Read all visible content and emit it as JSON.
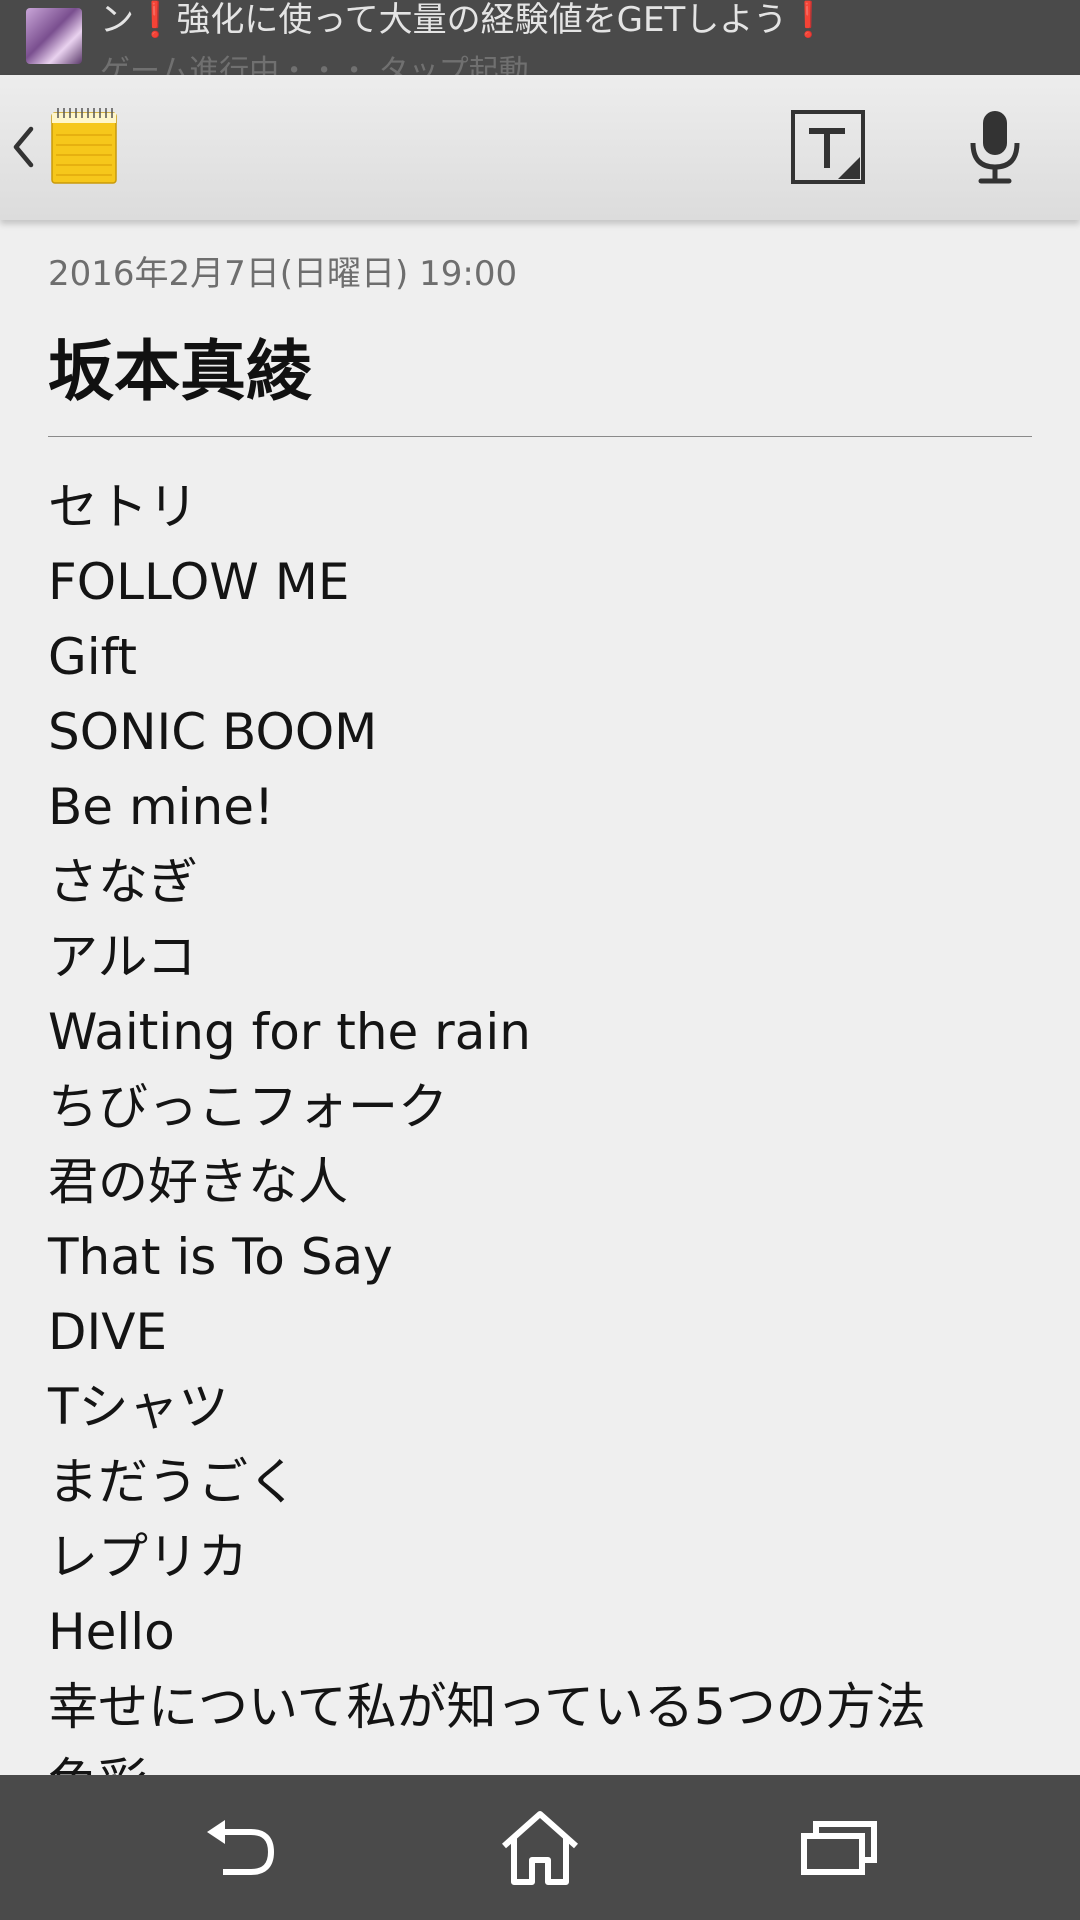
{
  "status_bar": {
    "notification_line_1": "ン❗強化に使って大量の経験値をGETしよう❗",
    "notification_line_2": "ゲーム進行中・・・ タップ起動"
  },
  "toolbar": {
    "back_icon": "chevron-left-icon",
    "app_icon": "notepad-icon",
    "format_icon": "text-format-icon",
    "mic_icon": "microphone-icon"
  },
  "note": {
    "date": "2016年2月7日(日曜日) 19:00",
    "title": "坂本真綾",
    "lines": [
      "セトリ",
      "FOLLOW ME",
      "Gift",
      "SONIC BOOM",
      "Be mine!",
      "さなぎ",
      "アルコ",
      "Waiting for the rain",
      "ちびっこフォーク",
      "君の好きな人",
      "That is To Say",
      "DIVE",
      "Tシャツ",
      "まだうごく",
      "レプリカ",
      "Hello",
      "幸せについて私が知っている5つの方法",
      "色彩"
    ]
  },
  "nav_bar": {
    "back": "back-icon",
    "home": "home-icon",
    "recents": "recent-apps-icon"
  },
  "colors": {
    "status_bar_bg": "#4a4a4a",
    "toolbar_bg": "#e4e4e4",
    "page_bg": "#efefef",
    "notepad_yellow": "#f5c518"
  }
}
